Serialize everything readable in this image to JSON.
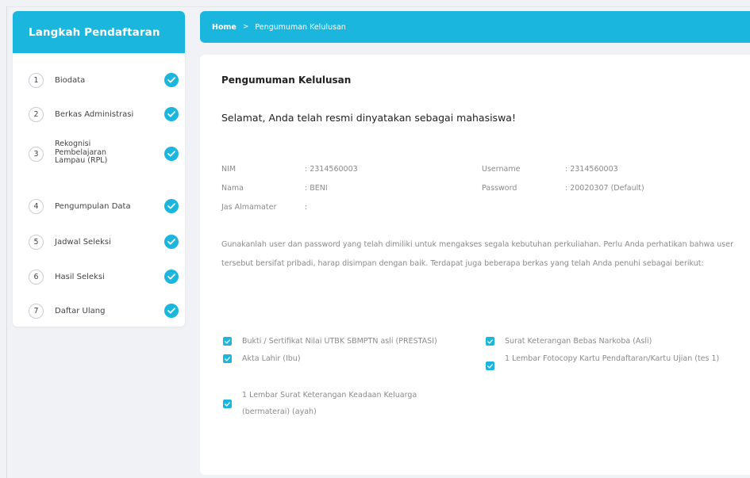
{
  "sidebar": {
    "title": "Langkah Pendaftaran",
    "steps": [
      {
        "num": "1",
        "label": "Biodata"
      },
      {
        "num": "2",
        "label": "Berkas Administrasi"
      },
      {
        "num": "3",
        "label": "Rekognisi Pembelajaran Lampau (RPL)"
      },
      {
        "num": "4",
        "label": "Pengumpulan Data"
      },
      {
        "num": "5",
        "label": "Jadwal Seleksi"
      },
      {
        "num": "6",
        "label": "Hasil Seleksi"
      },
      {
        "num": "7",
        "label": "Daftar Ulang"
      }
    ]
  },
  "breadcrumb": {
    "home": "Home",
    "separator": ">",
    "current": "Pengumuman Kelulusan"
  },
  "main": {
    "title": "Pengumuman Kelulusan",
    "congrats": "Selamat, Anda telah resmi dinyatakan sebagai mahasiswa!",
    "info": {
      "nim_label": "NIM",
      "nim_value": ": 2314560003",
      "nama_label": "Nama",
      "nama_value": ": BENI",
      "jas_label": "Jas Almamater",
      "jas_value": ":",
      "username_label": "Username",
      "username_value": ": 2314560003",
      "password_label": "Password",
      "password_value": ": 20020307 (Default)"
    },
    "paragraph": "Gunakanlah user dan password yang telah dimiliki untuk mengakses segala kebutuhan perkuliahan. Perlu Anda perhatikan bahwa user tersebut bersifat pribadi, harap disimpan dengan baik. Terdapat juga beberapa berkas yang telah Anda penuhi sebagai berikut:",
    "documents": {
      "left": [
        "Bukti / Sertifikat Nilai UTBK SBMPTN asli (PRESTASI)",
        "Akta Lahir (Ibu)",
        "1 Lembar Surat Keterangan Keadaan Keluarga (bermaterai) (ayah)"
      ],
      "right": [
        "Surat Keterangan Bebas Narkoba (Asli)",
        "1 Lembar Fotocopy Kartu Pendaftaran/Kartu Ujian (tes 1)"
      ]
    }
  },
  "colors": {
    "accent": "#1ab6dd",
    "background": "#f1f2f5"
  }
}
